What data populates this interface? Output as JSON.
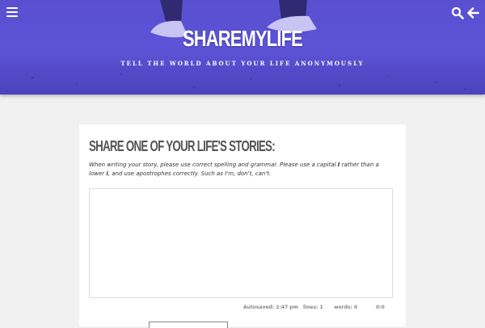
{
  "header": {
    "site_title": "SHAREMYLIFE",
    "tagline": "TELL THE WORLD ABOUT YOUR LIFE ANONYMOUSLY",
    "background_color": "#5b52d6",
    "icons": {
      "menu": "hamburger-menu-icon",
      "search": "search-icon",
      "back": "arrow-left-icon"
    }
  },
  "story_form": {
    "heading": "Share one of your life's stories:",
    "instructions": {
      "part1": "When writing your story, please use correct spelling and grammar. Please use a capital ",
      "capital_i": "I",
      "part2": " rather than a lower ",
      "lower_i": "i",
      "part3": ", and use apostrophes correctly. Such as I'm, don't, can't."
    },
    "story_text": "",
    "status": {
      "autosaved": "Autosaved: 2:47 pm",
      "lines": "lines: 1",
      "words": "words: 0",
      "position": "0:0"
    }
  }
}
